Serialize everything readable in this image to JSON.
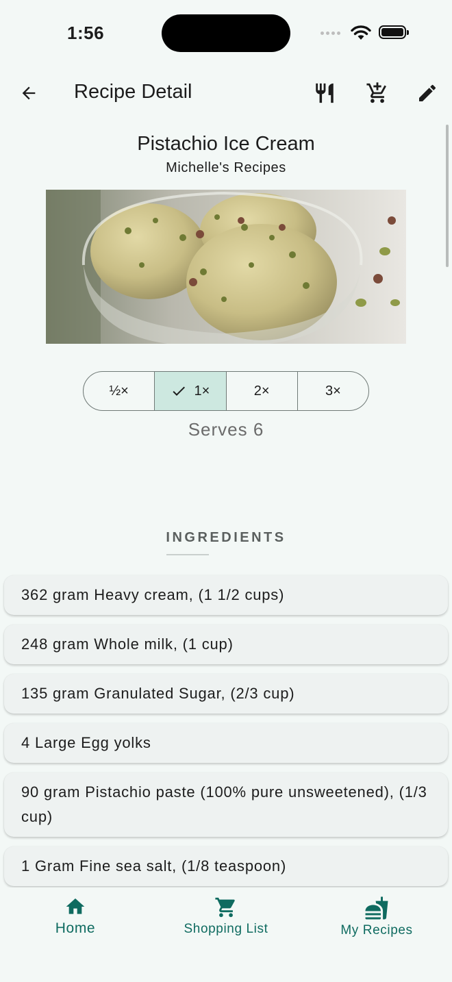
{
  "status_bar": {
    "time": "1:56"
  },
  "app_bar": {
    "title": "Recipe Detail",
    "icons": [
      "arrow-back-icon",
      "restaurant-icon",
      "add-shopping-cart-icon",
      "edit-icon"
    ]
  },
  "recipe": {
    "title": "Pistachio Ice Cream",
    "author": "Michelle's Recipes",
    "image_alt": "Pistachio ice cream in glass bowl"
  },
  "scale": {
    "options": [
      "½×",
      "1×",
      "2×",
      "3×"
    ],
    "selected": "1×",
    "serves": "Serves 6"
  },
  "ingredients": {
    "heading": "INGREDIENTS",
    "items": [
      "362 gram Heavy cream, (1 1/2 cups)",
      "248 gram Whole milk, (1 cup)",
      "135 gram Granulated Sugar, (2/3 cup)",
      "4 Large Egg yolks",
      "90 gram Pistachio paste (100% pure unsweetened), (1/3 cup)",
      "1 Gram Fine sea salt, (1/8 teaspoon)"
    ]
  },
  "bottom_nav": {
    "items": [
      {
        "label": "Home",
        "icon": "home-icon"
      },
      {
        "label": "Shopping List",
        "icon": "shopping-cart-icon"
      },
      {
        "label": "My Recipes",
        "icon": "my-recipes-icon"
      }
    ]
  },
  "colors": {
    "background": "#f3f8f6",
    "accent": "#0f6b60",
    "selected_segment": "#cde8e0",
    "card": "#eef2f1"
  }
}
